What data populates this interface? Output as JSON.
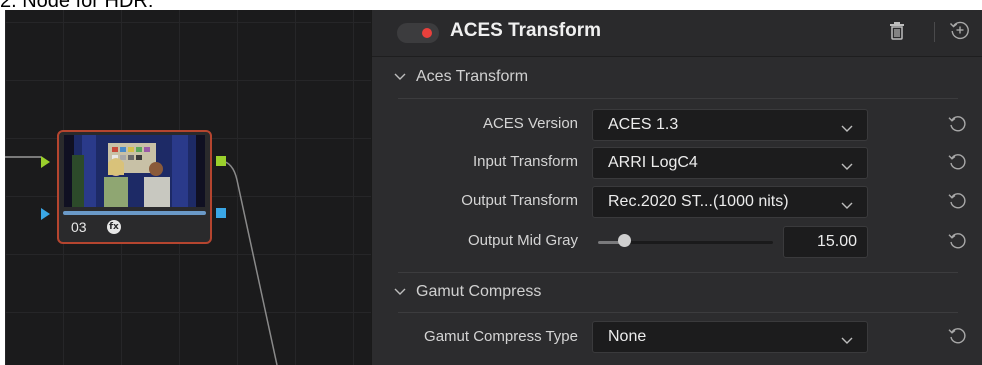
{
  "caption": "2. Node for HDR:",
  "node_graph": {
    "node": {
      "number": "03",
      "fx_label": "fx"
    }
  },
  "panel": {
    "title": "ACES Transform",
    "node_enabled": true,
    "sections": {
      "aces": {
        "label": "Aces Transform",
        "expanded": true
      },
      "gamut": {
        "label": "Gamut Compress",
        "expanded": true
      }
    },
    "aces_version": {
      "label": "ACES Version",
      "value": "ACES 1.3"
    },
    "input_transform": {
      "label": "Input Transform",
      "value": "ARRI LogC4"
    },
    "output_transform": {
      "label": "Output Transform",
      "value": "Rec.2020 ST...(1000 nits)"
    },
    "output_mid_gray": {
      "label": "Output Mid Gray",
      "value": "15.00",
      "slider_fraction": 0.15
    },
    "gamut_compress_type": {
      "label": "Gamut Compress Type",
      "value": "None"
    }
  },
  "colors": {
    "node_border": "#b5452f",
    "port_green": "#9bd02c",
    "port_blue": "#3aa7e6",
    "toggle_dot": "#e8403c"
  },
  "icons": [
    "trash-icon",
    "reset-all-icon",
    "reset-icon",
    "chevron-down-icon",
    "fx-icon"
  ]
}
